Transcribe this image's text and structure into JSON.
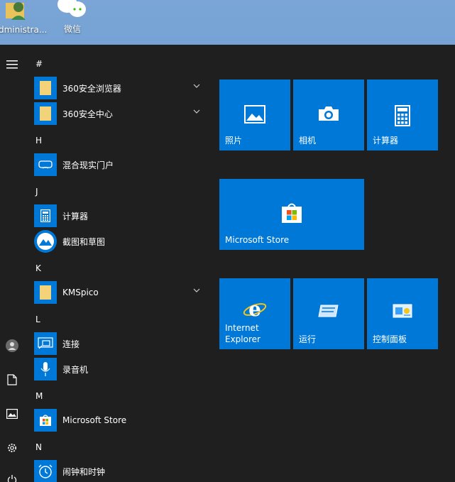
{
  "desktop": {
    "icons": [
      {
        "label": "dministra..."
      },
      {
        "label": "微信"
      }
    ]
  },
  "start_menu": {
    "groups": [
      {
        "letter": "#"
      },
      {
        "letter": "H"
      },
      {
        "letter": "J"
      },
      {
        "letter": "K"
      },
      {
        "letter": "L"
      },
      {
        "letter": "M"
      },
      {
        "letter": "N"
      }
    ],
    "apps": [
      {
        "label": "360安全浏览器"
      },
      {
        "label": "360安全中心"
      },
      {
        "label": "混合现实门户"
      },
      {
        "label": "计算器"
      },
      {
        "label": "截图和草图"
      },
      {
        "label": "KMSpico"
      },
      {
        "label": "连接"
      },
      {
        "label": "录音机"
      },
      {
        "label": "Microsoft Store"
      },
      {
        "label": "闹钟和时钟"
      }
    ],
    "tiles": [
      {
        "label": "照片"
      },
      {
        "label": "相机"
      },
      {
        "label": "计算器"
      },
      {
        "label": "Microsoft Store"
      },
      {
        "label": "Internet Explorer"
      },
      {
        "label": "运行"
      },
      {
        "label": "控制面板"
      }
    ],
    "colors": {
      "tile": "#0078d7",
      "background": "#1f1f1f"
    }
  }
}
